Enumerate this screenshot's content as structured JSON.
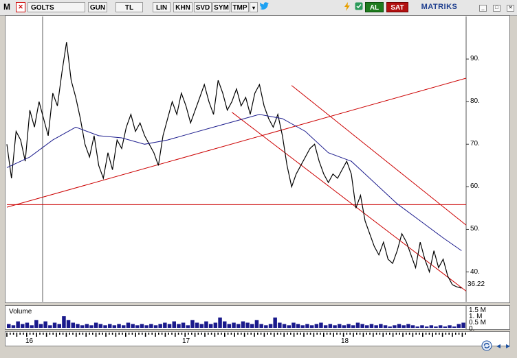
{
  "toolbar": {
    "logo": "M",
    "close_mark": "✕",
    "symbol": "GOLTS",
    "period": "GUN",
    "currency": "TL",
    "scale": "LIN",
    "buttons": [
      "KHN",
      "SVD",
      "SYM",
      "TMP"
    ],
    "dropdown": "▾",
    "twitter_icon": "twitter-icon",
    "bolt_icon": "bolt-icon",
    "check_icon": "check-icon",
    "buy_label": "AL",
    "sell_label": "SAT",
    "brand": "MATRIKS",
    "window_min": "_",
    "window_max": "□",
    "window_close": "✕"
  },
  "colors": {
    "price_line": "#000000",
    "moving_average": "#1a1a8c",
    "trend_lines": "#cc0000",
    "volume": "#1a1a8c",
    "buy": "#1e7b1e",
    "sell": "#b21010"
  },
  "chart_data": {
    "type": "line",
    "y_ticks": [
      "90.",
      "80.",
      "70.",
      "60.",
      "50.",
      "40."
    ],
    "last_value": "36.22",
    "x_ticks": [
      "16",
      "17",
      "18"
    ],
    "ylim": [
      33,
      100
    ],
    "x_range": [
      0,
      100
    ],
    "series": [
      {
        "role": "price",
        "x": [
          0,
          1,
          2,
          3,
          4,
          5,
          6,
          7,
          8,
          9,
          10,
          11,
          12,
          13,
          14,
          15,
          16,
          17,
          18,
          19,
          20,
          21,
          22,
          23,
          24,
          25,
          26,
          27,
          28,
          29,
          30,
          31,
          32,
          33,
          34,
          35,
          36,
          37,
          38,
          39,
          40,
          41,
          42,
          43,
          44,
          45,
          46,
          47,
          48,
          49,
          50,
          51,
          52,
          53,
          54,
          55,
          56,
          57,
          58,
          59,
          60,
          61,
          62,
          63,
          64,
          65,
          66,
          67,
          68,
          69,
          70,
          71,
          72,
          73,
          74,
          75,
          76,
          77,
          78,
          79,
          80,
          81,
          82,
          83,
          84,
          85,
          86,
          87,
          88,
          89,
          90,
          91,
          92,
          93,
          94,
          95,
          96,
          97,
          98,
          99
        ],
        "values": [
          70,
          62,
          73,
          71,
          66,
          78,
          74,
          80,
          76,
          72,
          82,
          79,
          87,
          94,
          85,
          81,
          76,
          70,
          67,
          72,
          65,
          62,
          68,
          64,
          71,
          69,
          74,
          77,
          73,
          75,
          72,
          70,
          68,
          65,
          72,
          76,
          80,
          77,
          82,
          79,
          75,
          78,
          81,
          84,
          80,
          77,
          85,
          82,
          78,
          80,
          83,
          79,
          81,
          77,
          82,
          84,
          79,
          76,
          74,
          77,
          72,
          65,
          60,
          63,
          65,
          67,
          69,
          70,
          66,
          63,
          61,
          63,
          62,
          64,
          66,
          63,
          55,
          58,
          52,
          49,
          46,
          44,
          47,
          43,
          42,
          45,
          49,
          47,
          44,
          41,
          47,
          43,
          40,
          45,
          41,
          43,
          39,
          37,
          36.5,
          36.2
        ]
      },
      {
        "role": "moving-average",
        "x": [
          0,
          5,
          10,
          15,
          20,
          25,
          30,
          35,
          40,
          45,
          50,
          55,
          60,
          65,
          70,
          75,
          80,
          85,
          90,
          95,
          99
        ],
        "values": [
          64.5,
          67,
          71,
          74,
          72,
          71.5,
          70,
          71,
          72.5,
          74,
          75.5,
          77,
          76,
          73,
          68,
          66,
          61,
          56,
          52,
          48,
          45
        ]
      }
    ],
    "trend_lines": [
      {
        "from": [
          0,
          55.2
        ],
        "to": [
          100,
          85.5
        ]
      },
      {
        "from": [
          0,
          55.8
        ],
        "to": [
          100,
          55.8
        ]
      },
      {
        "from": [
          49,
          77.5
        ],
        "to": [
          100,
          35.5
        ]
      },
      {
        "from": [
          62,
          83.8
        ],
        "to": [
          100,
          51
        ]
      }
    ],
    "volume": {
      "y_ticks": [
        "1.5 M",
        "1. M",
        "0.5 M",
        "0."
      ],
      "values": [
        0.3,
        0.2,
        0.5,
        0.3,
        0.4,
        0.2,
        0.6,
        0.3,
        0.5,
        0.2,
        0.4,
        0.3,
        0.9,
        0.6,
        0.4,
        0.3,
        0.2,
        0.3,
        0.2,
        0.4,
        0.3,
        0.2,
        0.3,
        0.2,
        0.3,
        0.2,
        0.4,
        0.3,
        0.2,
        0.3,
        0.2,
        0.3,
        0.2,
        0.3,
        0.4,
        0.3,
        0.5,
        0.3,
        0.4,
        0.2,
        0.6,
        0.4,
        0.3,
        0.5,
        0.3,
        0.4,
        0.8,
        0.5,
        0.3,
        0.4,
        0.3,
        0.5,
        0.4,
        0.3,
        0.6,
        0.3,
        0.2,
        0.3,
        0.8,
        0.4,
        0.3,
        0.2,
        0.4,
        0.3,
        0.2,
        0.3,
        0.2,
        0.3,
        0.4,
        0.2,
        0.3,
        0.2,
        0.3,
        0.2,
        0.3,
        0.2,
        0.4,
        0.3,
        0.2,
        0.3,
        0.2,
        0.3,
        0.2,
        0.1,
        0.2,
        0.3,
        0.2,
        0.3,
        0.2,
        0.1,
        0.2,
        0.1,
        0.2,
        0.1,
        0.2,
        0.1,
        0.2,
        0.1,
        0.3,
        0.4
      ]
    },
    "volume_label": "Volume",
    "volume_ylim": [
      0,
      1.6
    ]
  },
  "nav": {
    "refresh_icon": "refresh-icon",
    "prev_icon": "◂",
    "next_icon": "▸"
  }
}
